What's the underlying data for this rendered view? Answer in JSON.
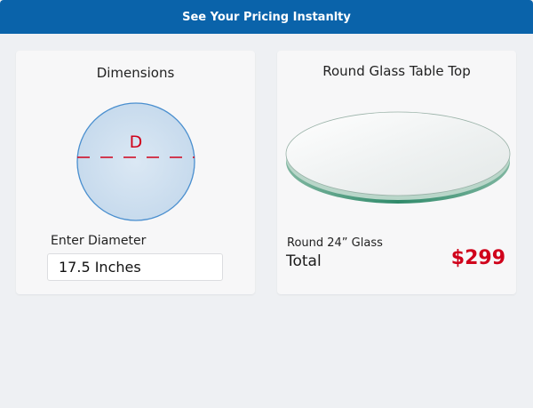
{
  "header": {
    "title": "See Your Pricing Instanlty"
  },
  "dimensions": {
    "title": "Dimensions",
    "diagram_label": "D",
    "diameter_label": "Enter Diameter",
    "diameter_value": "17.5 Inches"
  },
  "product": {
    "title": "Round Glass Table Top",
    "line": "Round 24” Glass",
    "total_label": "Total",
    "total_price": "$299"
  },
  "colors": {
    "header_bg": "#0a63aa",
    "accent_red": "#d0021b",
    "circle_fill": "#cfe0ef",
    "circle_stroke": "#4a8fcf",
    "glass_edge": "#2f8a6a"
  }
}
